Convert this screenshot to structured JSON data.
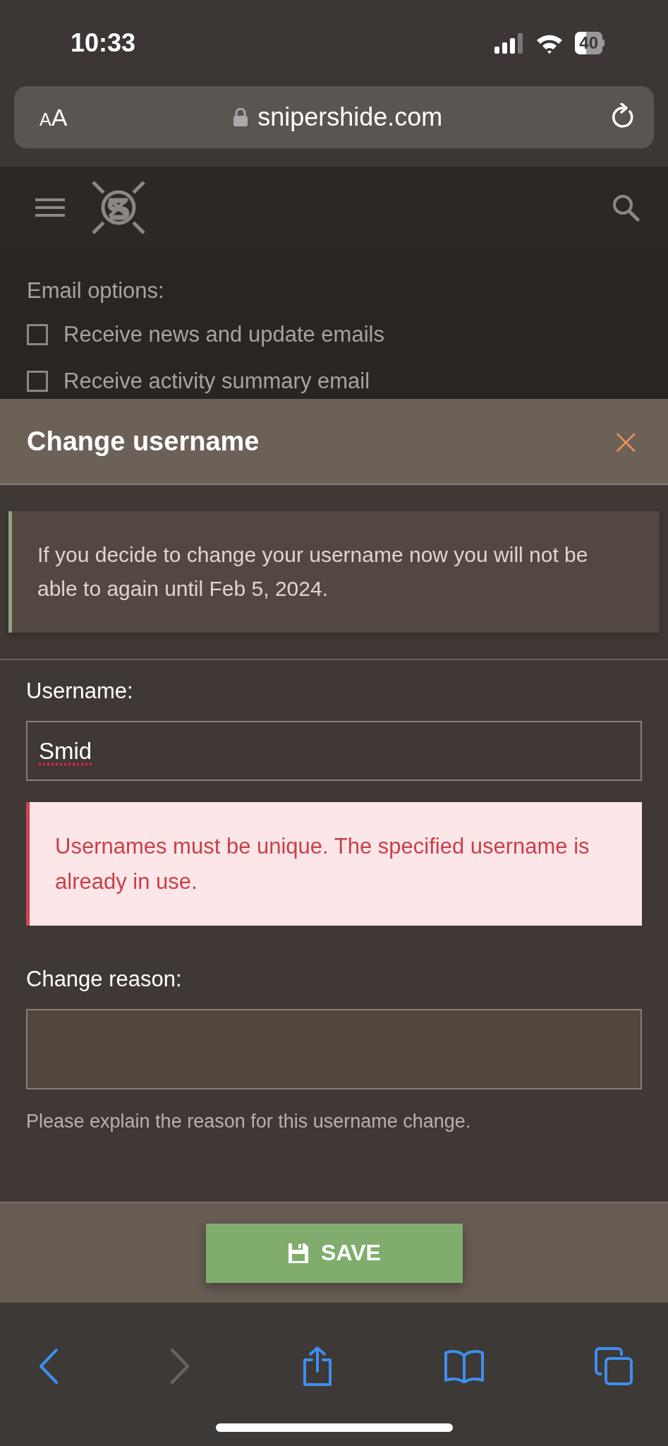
{
  "status_bar": {
    "time": "10:33",
    "battery": "40"
  },
  "address_bar": {
    "text_size_label": "AA",
    "url": "snipershide.com"
  },
  "page": {
    "section_label": "Email options:",
    "options": [
      {
        "label": "Receive news and update emails",
        "checked": false
      },
      {
        "label": "Receive activity summary email",
        "checked": false
      }
    ]
  },
  "modal": {
    "title": "Change username",
    "close": "×",
    "notice": "If you decide to change your username now you will not be able to again until Feb 5, 2024.",
    "username_label": "Username:",
    "username_value": "Smid",
    "error": "Usernames must be unique. The specified username is already in use.",
    "reason_label": "Change reason:",
    "reason_hint": "Please explain the reason for this username change.",
    "save_button": "SAVE"
  },
  "toolbar": {
    "items": [
      {
        "kind": "back",
        "disabled": false
      },
      {
        "kind": "forward",
        "disabled": true
      },
      {
        "kind": "share",
        "disabled": false
      },
      {
        "kind": "bookmarks",
        "disabled": false
      },
      {
        "kind": "tabs",
        "disabled": false
      }
    ]
  }
}
